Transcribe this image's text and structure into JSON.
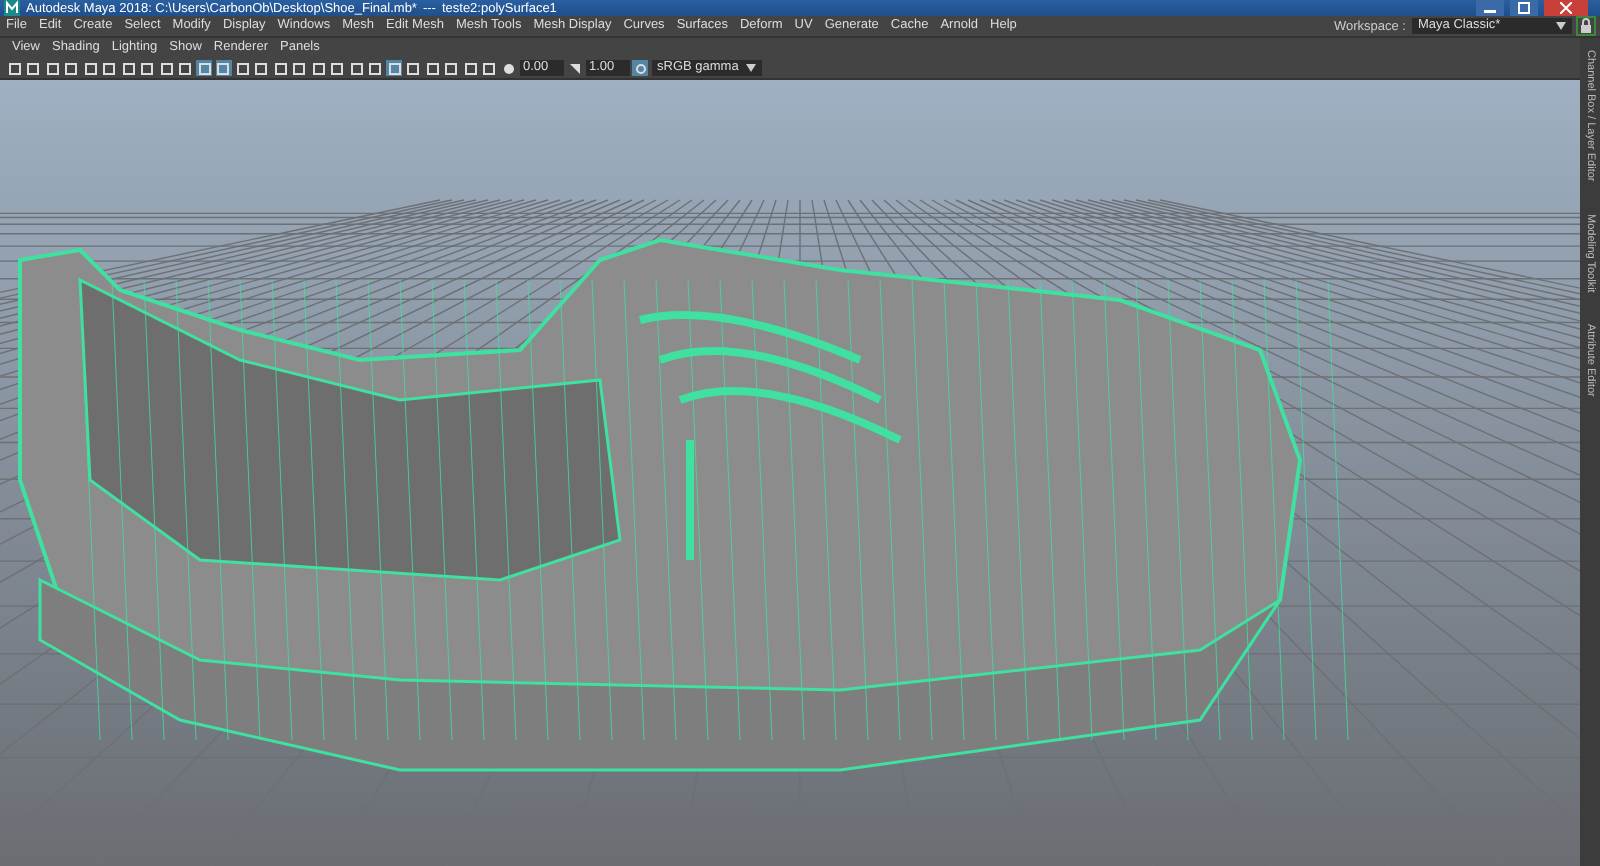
{
  "window": {
    "title": "Autodesk Maya 2018: C:\\Users\\CarbonOb\\Desktop\\Shoe_Final.mb*",
    "separator": "---",
    "object": "teste2:polySurface1"
  },
  "menu_bar": [
    "File",
    "Edit",
    "Create",
    "Select",
    "Modify",
    "Display",
    "Windows",
    "Mesh",
    "Edit Mesh",
    "Mesh Tools",
    "Mesh Display",
    "Curves",
    "Surfaces",
    "Deform",
    "UV",
    "Generate",
    "Cache",
    "Arnold",
    "Help"
  ],
  "workspace": {
    "label": "Workspace :",
    "value": "Maya Classic*"
  },
  "panel_menu": [
    "View",
    "Shading",
    "Lighting",
    "Show",
    "Renderer",
    "Panels"
  ],
  "panel_toolbar": {
    "exposure": "0.00",
    "gamma": "1.00",
    "color_space": "sRGB gamma"
  },
  "side_tabs": [
    "Channel Box / Layer Editor",
    "Modeling Toolkit",
    "Attribute Editor"
  ]
}
